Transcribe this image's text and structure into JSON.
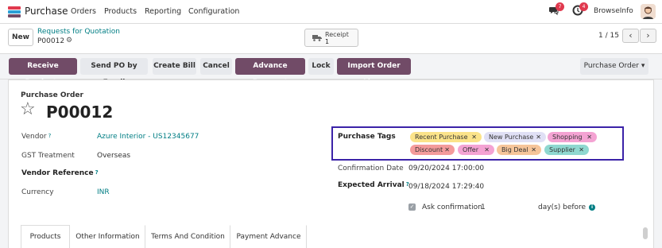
{
  "navbar": {
    "app_name": "Purchase",
    "menu": [
      "Orders",
      "Products",
      "Reporting",
      "Configuration"
    ],
    "chat_count": "7",
    "activity_count": "4",
    "company": "BrowseInfo",
    "icons": [
      "apps-grid-icon",
      "chat-icon",
      "clock-icon",
      "avatar"
    ]
  },
  "control": {
    "new_label": "New",
    "breadcrumb_parent": "Requests for Quotation",
    "breadcrumb_current": "P00012",
    "receipt_label": "Receipt",
    "receipt_count": "1",
    "pager": "1 / 15",
    "prev": "‹",
    "next": "›"
  },
  "actions": {
    "receive_products": "Receive Products",
    "send_po": "Send PO by Email",
    "create_bill": "Create Bill",
    "cancel": "Cancel",
    "advance_payment": "Advance Payment",
    "lock": "Lock",
    "import_order_lines": "Import Order Lines",
    "report": "Purchase Order ▾"
  },
  "form": {
    "doc_type": "Purchase Order",
    "title": "P00012",
    "vendor_label": "Vendor",
    "vendor_value": "Azure Interior - US12345677",
    "gst_label": "GST Treatment",
    "gst_value": "Overseas",
    "vendor_ref_label": "Vendor Reference",
    "currency_label": "Currency",
    "currency_value": "INR",
    "tags_label": "Purchase Tags",
    "tags": [
      {
        "label": "Recent Purchase",
        "color": "#fbe38a"
      },
      {
        "label": "New Purchase",
        "color": "#e0e0f5"
      },
      {
        "label": "Shopping",
        "color": "#f4a3d3"
      },
      {
        "label": "Discount",
        "color": "#f49b9b"
      },
      {
        "label": "Offer",
        "color": "#f4a3d3"
      },
      {
        "label": "Big Deal",
        "color": "#f6c59a"
      },
      {
        "label": "Supplier",
        "color": "#8fd8d0"
      }
    ],
    "confirmation_label": "Confirmation Date",
    "confirmation_value": "09/20/2024 17:00:00",
    "arrival_label": "Expected Arrival",
    "arrival_value": "09/18/2024 17:29:40",
    "ask_label": "Ask confirmation",
    "ask_days": "1",
    "days_before": "day(s) before"
  },
  "tabs": [
    "Products",
    "Other Information",
    "Terms And Condition",
    "Payment Advance"
  ],
  "colors": {
    "primary": "#714b67",
    "link": "#017e84",
    "highlight_border": "#3b23a8"
  }
}
